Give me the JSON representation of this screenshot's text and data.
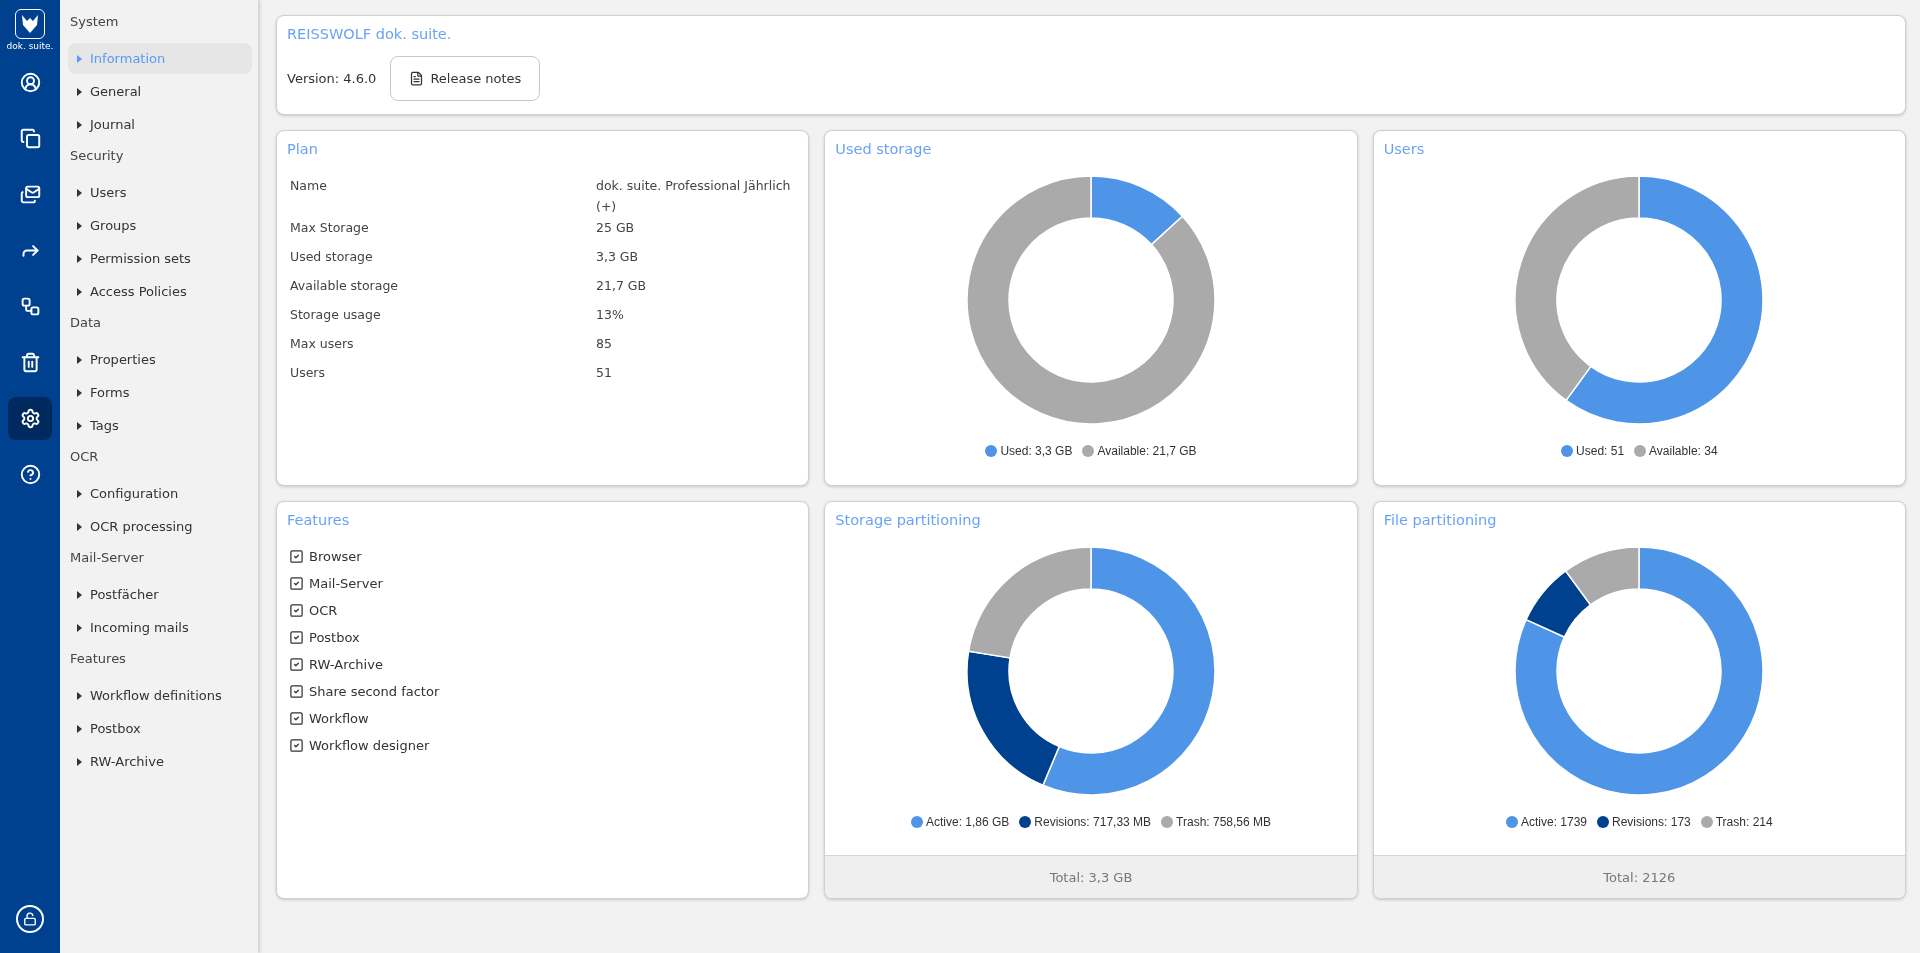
{
  "rail": {
    "logo_text": "dok. suite.",
    "items": [
      {
        "kind": "user",
        "selected": false
      },
      {
        "kind": "documents",
        "selected": false
      },
      {
        "kind": "mail",
        "selected": false
      },
      {
        "kind": "forward",
        "selected": false
      },
      {
        "kind": "workflow",
        "selected": false
      },
      {
        "kind": "trash",
        "selected": false
      },
      {
        "kind": "settings",
        "selected": true
      },
      {
        "kind": "help",
        "selected": false
      }
    ],
    "bottom": {
      "kind": "unlock",
      "selected": false
    }
  },
  "sidebar": {
    "groups": [
      {
        "title": "System",
        "items": [
          {
            "label": "Information",
            "selected": true
          },
          {
            "label": "General",
            "selected": false
          },
          {
            "label": "Journal",
            "selected": false
          }
        ]
      },
      {
        "title": "Security",
        "items": [
          {
            "label": "Users",
            "selected": false
          },
          {
            "label": "Groups",
            "selected": false
          },
          {
            "label": "Permission sets",
            "selected": false
          },
          {
            "label": "Access Policies",
            "selected": false
          }
        ]
      },
      {
        "title": "Data",
        "items": [
          {
            "label": "Properties",
            "selected": false
          },
          {
            "label": "Forms",
            "selected": false
          },
          {
            "label": "Tags",
            "selected": false
          }
        ]
      },
      {
        "title": "OCR",
        "items": [
          {
            "label": "Configuration",
            "selected": false
          },
          {
            "label": "OCR processing",
            "selected": false
          }
        ]
      },
      {
        "title": "Mail-Server",
        "items": [
          {
            "label": "Postfächer",
            "selected": false
          },
          {
            "label": "Incoming mails",
            "selected": false
          }
        ]
      },
      {
        "title": "Features",
        "items": [
          {
            "label": "Workflow definitions",
            "selected": false
          },
          {
            "label": "Postbox",
            "selected": false
          },
          {
            "label": "RW-Archive",
            "selected": false
          }
        ]
      }
    ]
  },
  "header": {
    "title": "REISSWOLF dok. suite.",
    "version": "Version: 4.6.0",
    "button": "Release notes"
  },
  "plan": {
    "title": "Plan",
    "rows": [
      {
        "label": "Name",
        "value": "dok. suite. Professional Jährlich (+)"
      },
      {
        "label": "Max Storage",
        "value": "25 GB"
      },
      {
        "label": "Used storage",
        "value": "3,3 GB"
      },
      {
        "label": "Available storage",
        "value": "21,7 GB"
      },
      {
        "label": "Storage usage",
        "value": "13%"
      },
      {
        "label": "Max users",
        "value": "85"
      },
      {
        "label": "Users",
        "value": "51"
      }
    ]
  },
  "features": {
    "title": "Features",
    "items": [
      {
        "label": "Browser",
        "checked": true
      },
      {
        "label": "Mail-Server",
        "checked": true
      },
      {
        "label": "OCR",
        "checked": true
      },
      {
        "label": "Postbox",
        "checked": true
      },
      {
        "label": "RW-Archive",
        "checked": true
      },
      {
        "label": "Share second factor",
        "checked": true
      },
      {
        "label": "Workflow",
        "checked": true
      },
      {
        "label": "Workflow designer",
        "checked": true
      }
    ]
  },
  "charts": [
    {
      "title": "Used storage",
      "legend": [
        {
          "color": "#4e95e8"
        },
        {
          "color": "#aaaaaa"
        }
      ],
      "chart_data": {
        "type": "donut",
        "categories": [
          "Used: 3,3 GB",
          "Available: 21,7 GB"
        ],
        "values": [
          3.3,
          21.7
        ]
      }
    },
    {
      "title": "Users",
      "legend": [
        {
          "color": "#4e95e8"
        },
        {
          "color": "#aaaaaa"
        }
      ],
      "chart_data": {
        "type": "donut",
        "categories": [
          "Used: 51",
          "Available: 34"
        ],
        "values": [
          51,
          34
        ]
      }
    },
    {
      "title": "Storage partitioning",
      "legend": [
        {
          "color": "#4e95e8"
        },
        {
          "color": "#00418f"
        },
        {
          "color": "#aaaaaa"
        }
      ],
      "chart_data": {
        "type": "donut",
        "categories": [
          "Active: 1,86 GB",
          "Revisions: 717,33 MB",
          "Trash: 758,56 MB"
        ],
        "values": [
          56.34,
          21.22,
          22.44
        ]
      },
      "total": "Total: 3,3 GB"
    },
    {
      "title": "File partitioning",
      "legend": [
        {
          "color": "#4e95e8"
        },
        {
          "color": "#00418f"
        },
        {
          "color": "#aaaaaa"
        }
      ],
      "chart_data": {
        "type": "donut",
        "categories": [
          "Active: 1739",
          "Revisions: 173",
          "Trash: 214"
        ],
        "values": [
          1739,
          173,
          214
        ]
      },
      "total": "Total: 2126"
    }
  ]
}
